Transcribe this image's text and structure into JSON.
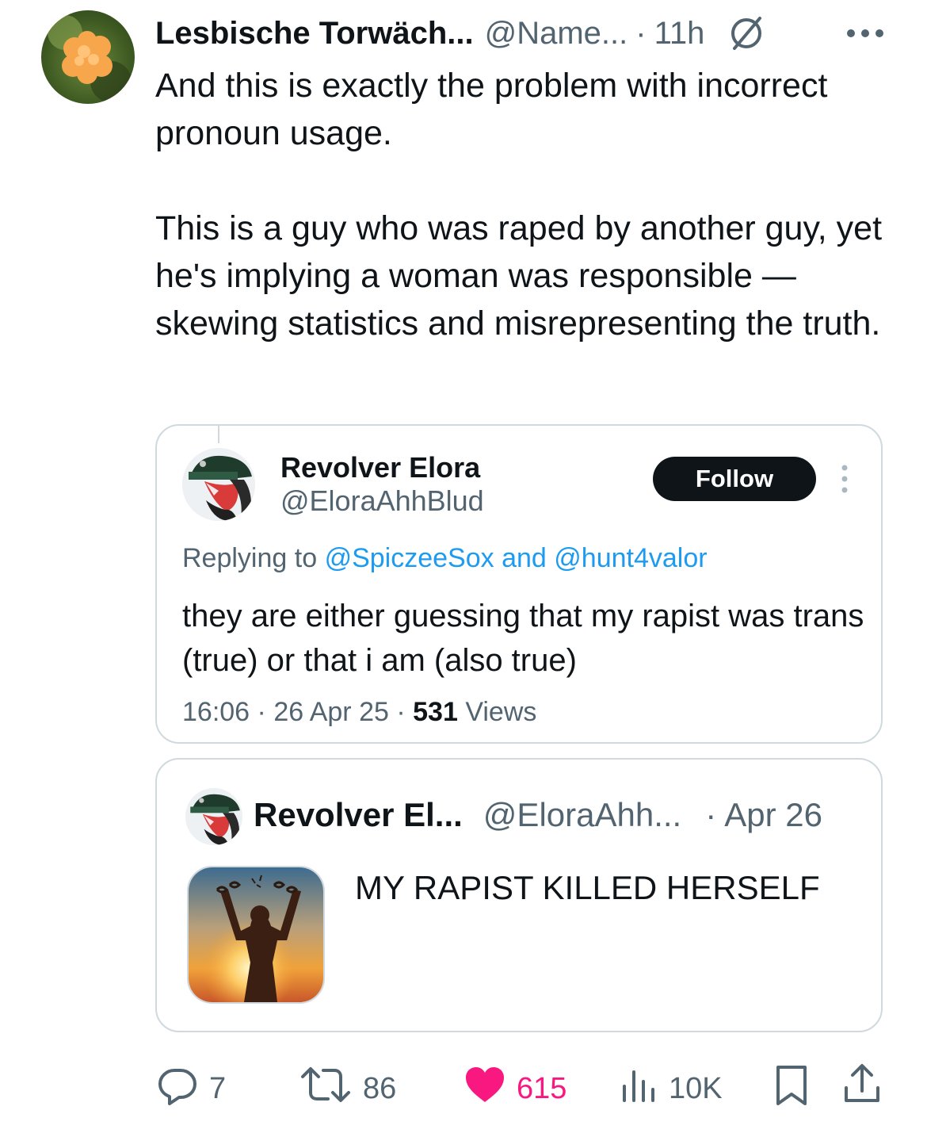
{
  "tweet": {
    "author_name": "Lesbische Torwäch...",
    "author_handle": "@Name...",
    "separator": "·",
    "time": "11h",
    "paragraph_1": "And this is exactly the problem with incorrect pronoun usage.",
    "paragraph_2": "This is a guy who was raped by another guy, yet he's implying a woman was responsible — skewing statistics and misrepresenting the truth."
  },
  "quote_1": {
    "name": "Revolver Elora",
    "handle": "@EloraAhhBlud",
    "follow_label": "Follow",
    "replying_prefix": "Replying to",
    "replying_user_1": "@SpiczeeSox",
    "replying_and": "and",
    "replying_user_2": "@hunt4valor",
    "text": "they are either guessing that my rapist was trans (true) or that i am (also true)",
    "time": "16:06",
    "separator": "·",
    "date": "26 Apr 25",
    "views_count": "531",
    "views_label": "Views"
  },
  "quote_2": {
    "name": "Revolver El...",
    "handle": "@EloraAhh...",
    "separator": "·",
    "date": "Apr 26",
    "text": "MY RAPIST KILLED HERSELF"
  },
  "actions": {
    "replies": "7",
    "reposts": "86",
    "likes": "615",
    "views": "10K"
  },
  "colors": {
    "text_primary": "#0f1419",
    "text_secondary": "#536471",
    "link": "#1d9bf0",
    "like": "#f91880",
    "border": "#cfd9de"
  },
  "icons": [
    "no-symbol-icon",
    "more-icon",
    "kebab-icon",
    "reply-icon",
    "repost-icon",
    "heart-icon",
    "views-icon",
    "bookmark-icon",
    "share-icon"
  ]
}
